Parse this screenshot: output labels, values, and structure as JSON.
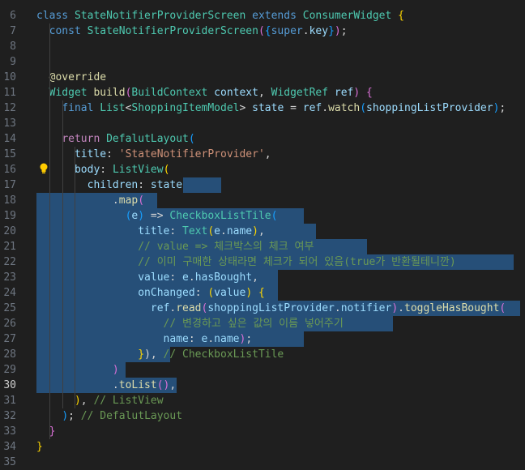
{
  "editor": {
    "active_line": 30,
    "lines": [
      {
        "n": 6,
        "segments": [
          [
            "kw",
            "class "
          ],
          [
            "ty",
            "StateNotifierProviderScreen "
          ],
          [
            "kw",
            "extends "
          ],
          [
            "ty",
            "ConsumerWidget "
          ],
          [
            "b1",
            "{"
          ]
        ]
      },
      {
        "n": 7,
        "segments": [
          [
            "pl",
            "  "
          ],
          [
            "kw",
            "const "
          ],
          [
            "ty",
            "StateNotifierProviderScreen"
          ],
          [
            "b2",
            "("
          ],
          [
            "b3",
            "{"
          ],
          [
            "kw",
            "super"
          ],
          [
            "pl",
            "."
          ],
          [
            "var",
            "key"
          ],
          [
            "b3",
            "}"
          ],
          [
            "b2",
            ")"
          ],
          [
            "pl",
            ";"
          ]
        ]
      },
      {
        "n": 8,
        "segments": []
      },
      {
        "n": 9,
        "segments": []
      },
      {
        "n": 10,
        "segments": [
          [
            "pl",
            "  "
          ],
          [
            "ann",
            "@override"
          ]
        ]
      },
      {
        "n": 11,
        "segments": [
          [
            "pl",
            "  "
          ],
          [
            "ty",
            "Widget "
          ],
          [
            "fn",
            "build"
          ],
          [
            "b2",
            "("
          ],
          [
            "ty",
            "BuildContext "
          ],
          [
            "var",
            "context"
          ],
          [
            "pl",
            ", "
          ],
          [
            "ty",
            "WidgetRef "
          ],
          [
            "var",
            "ref"
          ],
          [
            "b2",
            ")"
          ],
          [
            "pl",
            " "
          ],
          [
            "b2",
            "{"
          ]
        ]
      },
      {
        "n": 12,
        "segments": [
          [
            "pl",
            "    "
          ],
          [
            "kw",
            "final "
          ],
          [
            "ty",
            "List"
          ],
          [
            "pl",
            "<"
          ],
          [
            "ty",
            "ShoppingItemModel"
          ],
          [
            "pl",
            "> "
          ],
          [
            "var",
            "state "
          ],
          [
            "pl",
            "= "
          ],
          [
            "var",
            "ref"
          ],
          [
            "pl",
            "."
          ],
          [
            "fn",
            "watch"
          ],
          [
            "b3",
            "("
          ],
          [
            "var",
            "shoppingListProvider"
          ],
          [
            "b3",
            ")"
          ],
          [
            "pl",
            ";"
          ]
        ]
      },
      {
        "n": 13,
        "segments": []
      },
      {
        "n": 14,
        "segments": [
          [
            "pl",
            "    "
          ],
          [
            "kw2",
            "return "
          ],
          [
            "ty",
            "DefalutLayout"
          ],
          [
            "b3",
            "("
          ]
        ]
      },
      {
        "n": 15,
        "segments": [
          [
            "pl",
            "      "
          ],
          [
            "var",
            "title"
          ],
          [
            "pl",
            ": "
          ],
          [
            "str",
            "'StateNotifierProvider'"
          ],
          [
            "pl",
            ","
          ]
        ]
      },
      {
        "n": 16,
        "segments": [
          [
            "pl",
            "      "
          ],
          [
            "var",
            "body"
          ],
          [
            "pl",
            ": "
          ],
          [
            "ty",
            "ListView"
          ],
          [
            "b1",
            "("
          ]
        ]
      },
      {
        "n": 17,
        "segments": [
          [
            "pl",
            "        "
          ],
          [
            "var",
            "children"
          ],
          [
            "pl",
            ": "
          ],
          [
            "var",
            "state "
          ]
        ]
      },
      {
        "n": 18,
        "segments": [
          [
            "pl",
            "            ."
          ],
          [
            "fn",
            "map"
          ],
          [
            "b2",
            "("
          ]
        ]
      },
      {
        "n": 19,
        "segments": [
          [
            "pl",
            "              "
          ],
          [
            "b3",
            "("
          ],
          [
            "var",
            "e"
          ],
          [
            "b3",
            ")"
          ],
          [
            "pl",
            " => "
          ],
          [
            "ty",
            "CheckboxListTile"
          ],
          [
            "b3",
            "("
          ]
        ]
      },
      {
        "n": 20,
        "segments": [
          [
            "pl",
            "                "
          ],
          [
            "var",
            "title"
          ],
          [
            "pl",
            ": "
          ],
          [
            "ty",
            "Text"
          ],
          [
            "b1",
            "("
          ],
          [
            "var",
            "e"
          ],
          [
            "pl",
            "."
          ],
          [
            "var",
            "name"
          ],
          [
            "b1",
            ")"
          ],
          [
            "pl",
            ","
          ]
        ]
      },
      {
        "n": 21,
        "segments": [
          [
            "pl",
            "                "
          ],
          [
            "cm",
            "// value => 체크박스의 체크 여부"
          ]
        ]
      },
      {
        "n": 22,
        "segments": [
          [
            "pl",
            "                "
          ],
          [
            "cm",
            "// 이미 구매한 상태라면 체크가 되어 있음(true가 반환될테니깐)"
          ]
        ]
      },
      {
        "n": 23,
        "segments": [
          [
            "pl",
            "                "
          ],
          [
            "var",
            "value"
          ],
          [
            "pl",
            ": "
          ],
          [
            "var",
            "e"
          ],
          [
            "pl",
            "."
          ],
          [
            "var",
            "hasBought"
          ],
          [
            "pl",
            ","
          ]
        ]
      },
      {
        "n": 24,
        "segments": [
          [
            "pl",
            "                "
          ],
          [
            "var",
            "onChanged"
          ],
          [
            "pl",
            ": "
          ],
          [
            "b1",
            "("
          ],
          [
            "var",
            "value"
          ],
          [
            "b1",
            ")"
          ],
          [
            "pl",
            " "
          ],
          [
            "b1",
            "{"
          ]
        ]
      },
      {
        "n": 25,
        "segments": [
          [
            "pl",
            "                  "
          ],
          [
            "var",
            "ref"
          ],
          [
            "pl",
            "."
          ],
          [
            "fn",
            "read"
          ],
          [
            "b2",
            "("
          ],
          [
            "var",
            "shoppingListProvider"
          ],
          [
            "pl",
            "."
          ],
          [
            "var",
            "notifier"
          ],
          [
            "b2",
            ")"
          ],
          [
            "pl",
            "."
          ],
          [
            "fn",
            "toggleHasBought"
          ],
          [
            "b2",
            "("
          ]
        ]
      },
      {
        "n": 26,
        "segments": [
          [
            "pl",
            "                    "
          ],
          [
            "cm",
            "// 변경하고 싶은 값의 이름 넣어주기"
          ]
        ]
      },
      {
        "n": 27,
        "segments": [
          [
            "pl",
            "                    "
          ],
          [
            "var",
            "name"
          ],
          [
            "pl",
            ": "
          ],
          [
            "var",
            "e"
          ],
          [
            "pl",
            "."
          ],
          [
            "var",
            "name"
          ],
          [
            "b2",
            ")"
          ],
          [
            "pl",
            ";"
          ]
        ]
      },
      {
        "n": 28,
        "segments": [
          [
            "pl",
            "                "
          ],
          [
            "b1",
            "}"
          ],
          [
            "pl",
            "), "
          ],
          [
            "cm",
            "// CheckboxListTile"
          ]
        ]
      },
      {
        "n": 29,
        "segments": [
          [
            "pl",
            "            "
          ],
          [
            "b2",
            ")"
          ]
        ]
      },
      {
        "n": 30,
        "segments": [
          [
            "pl",
            "            ."
          ],
          [
            "fn",
            "toList"
          ],
          [
            "b2",
            "()"
          ],
          [
            "pl",
            ","
          ]
        ]
      },
      {
        "n": 31,
        "segments": [
          [
            "pl",
            "      "
          ],
          [
            "b1",
            ")"
          ],
          [
            "pl",
            ", "
          ],
          [
            "cm",
            "// ListView"
          ]
        ]
      },
      {
        "n": 32,
        "segments": [
          [
            "pl",
            "    "
          ],
          [
            "b3",
            ")"
          ],
          [
            "pl",
            "; "
          ],
          [
            "cm",
            "// DefalutLayout"
          ]
        ]
      },
      {
        "n": 33,
        "segments": [
          [
            "pl",
            "  "
          ],
          [
            "b2",
            "}"
          ]
        ]
      },
      {
        "n": 34,
        "segments": [
          [
            "b1",
            "}"
          ]
        ]
      },
      {
        "n": 35,
        "segments": []
      }
    ]
  },
  "colors": {
    "background": "#1f1f1f",
    "selection": "#264f78",
    "lightbulb": "#ffcc00"
  },
  "icons": {
    "lightbulb": "lightbulb-icon"
  }
}
